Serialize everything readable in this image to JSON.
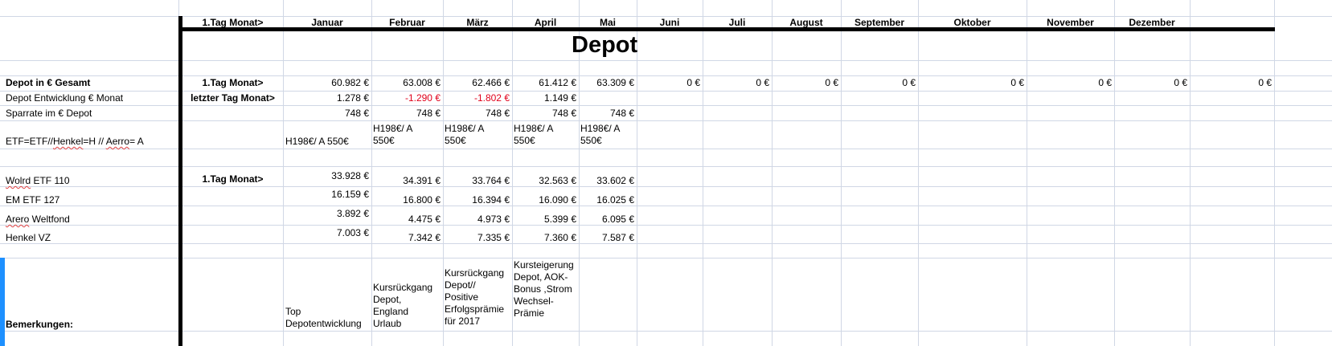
{
  "header": {
    "tag_label": "1.Tag Monat>",
    "months": [
      "Januar",
      "Februar",
      "März",
      "April",
      "Mai",
      "Juni",
      "Juli",
      "August",
      "September",
      "Oktober",
      "November",
      "Dezember"
    ]
  },
  "title": "Depot",
  "rows": {
    "gesamt": {
      "label": "Depot in € Gesamt",
      "marker": "1.Tag Monat>",
      "values": [
        "60.982 €",
        "63.008 €",
        "62.466 €",
        "61.412 €",
        "63.309 €",
        "0 €",
        "0 €",
        "0 €",
        "0 €",
        "0 €",
        "0 €",
        "0 €",
        "0 €"
      ]
    },
    "entwicklung": {
      "label": "Depot Entwicklung € Monat",
      "marker": "letzter Tag Monat>",
      "values": [
        "1.278 €",
        "-1.290 €",
        "-1.802 €",
        "1.149 €"
      ]
    },
    "sparrate": {
      "label": "Sparrate im € Depot",
      "values": [
        "748 €",
        "748 €",
        "748 €",
        "748 €",
        "748 €"
      ]
    },
    "etf_legend": {
      "label_prefix": "ETF=ETF//",
      "label_henkel": "Henkel",
      "label_mid": "=H // ",
      "label_aerro": "Aerro",
      "label_suffix": "= A",
      "jan": "H198€/ A 550€",
      "feb": "H198€/ A\n550€",
      "mar": "H198€/ A\n550€",
      "apr": "H198€/ A\n550€",
      "may": "H198€/ A\n550€"
    },
    "marker_holdings": "1.Tag Monat>",
    "world_etf": {
      "label_a": "Wolrd",
      "label_b": " ETF 110",
      "values": [
        "33.928 €",
        "34.391 €",
        "33.764 €",
        "32.563 €",
        "33.602 €"
      ]
    },
    "em_etf": {
      "label": "EM ETF 127",
      "values": [
        "16.159 €",
        "16.800 €",
        "16.394 €",
        "16.090 €",
        "16.025 €"
      ]
    },
    "arero": {
      "label_a": "Arero",
      "label_b": " Weltfond",
      "values": [
        "3.892 €",
        "4.475 €",
        "4.973 €",
        "5.399 €",
        "6.095 €"
      ]
    },
    "henkel": {
      "label": "Henkel VZ",
      "values": [
        "7.003 €",
        "7.342 €",
        "7.335 €",
        "7.360 €",
        "7.587 €"
      ]
    },
    "bemerkungen": {
      "label": "Bemerkungen:",
      "jan": "Top\nDepotentwicklung",
      "feb": "Kursrückgang\nDepot,\nEngland\nUrlaub",
      "mar": "Kursrückgang\nDepot//\nPositive\nErfolgsprämie\nfür 2017",
      "apr": "Kursteigerung\n Depot, AOK-\nBonus ,Strom\n Wechsel-\nPrämie"
    }
  },
  "colors": {
    "grid": "#d0d7e5",
    "negative": "#e0001b",
    "selection": "#1e90ff"
  }
}
